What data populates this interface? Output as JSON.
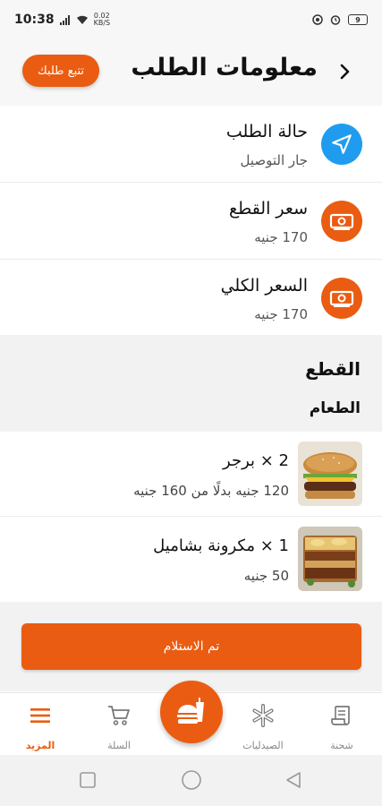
{
  "status_bar": {
    "time": "10:38",
    "net_speed_value": "0.02",
    "net_speed_unit": "KB/S",
    "battery": "9"
  },
  "header": {
    "title": "معلومات الطلب",
    "track_button": "تتبع طلبك"
  },
  "info": {
    "status_label": "حالة الطلب",
    "status_value": "جار التوصيل",
    "items_price_label": "سعر القطع",
    "items_price_value": "170 جنيه",
    "total_label": "السعر الكلي",
    "total_value": "170 جنيه"
  },
  "section": {
    "title": "القطع",
    "subtitle": "الطعام"
  },
  "items": [
    {
      "title": "2 × برجر",
      "price": "120 جنيه بدلًا من 160 جنيه"
    },
    {
      "title": "1 × مكرونة بشاميل",
      "price": "50 جنيه"
    }
  ],
  "received_button": "تم الاستلام",
  "nav": {
    "more": "المزيد",
    "cart": "السلة",
    "pharmacies": "الصيدليات",
    "shipment": "شحنة"
  },
  "colors": {
    "accent": "#ea5c11",
    "status_icon": "#1f9cf0"
  }
}
